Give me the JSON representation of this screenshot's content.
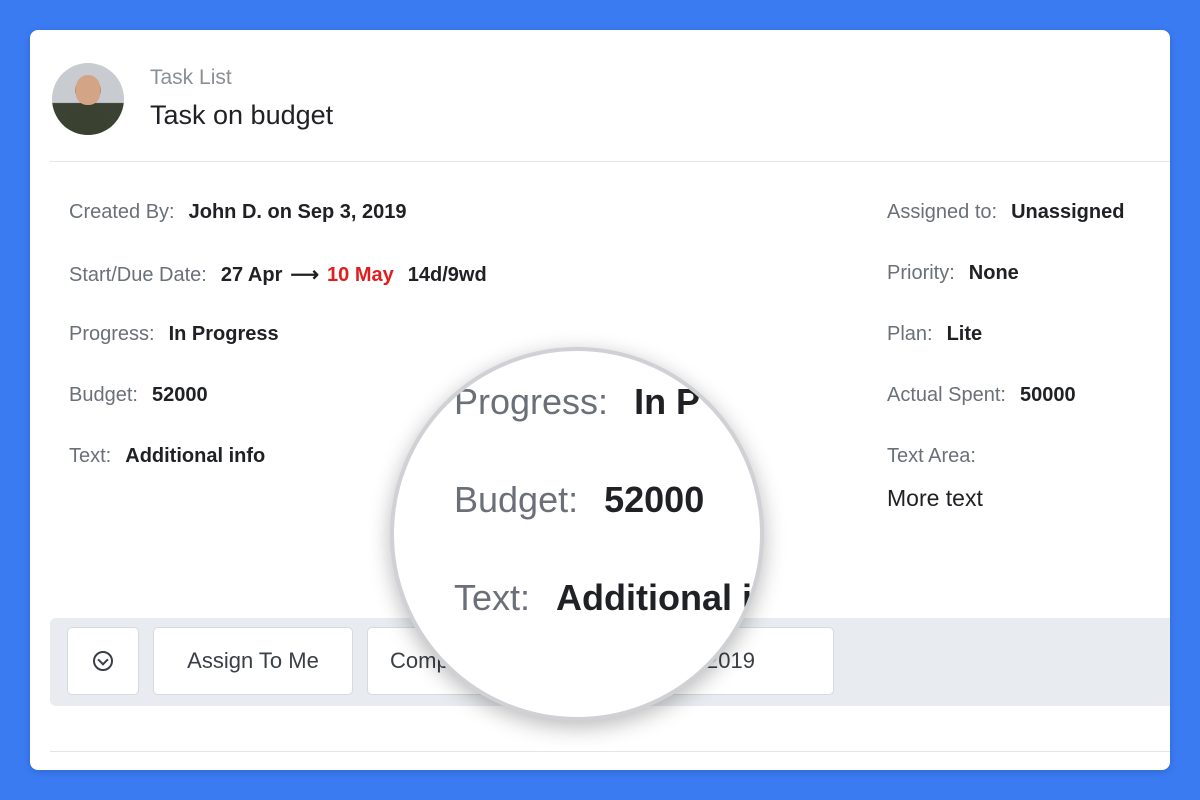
{
  "header": {
    "subtitle": "Task List",
    "title": "Task on budget"
  },
  "fields_left": {
    "created_by": {
      "label": "Created By:",
      "value": "John D. on Sep 3, 2019"
    },
    "dates": {
      "label": "Start/Due Date:",
      "start": "27 Apr",
      "arrow": "⟶",
      "due": "10 May",
      "duration": "14d/9wd"
    },
    "progress": {
      "label": "Progress:",
      "value": "In Progress"
    },
    "budget": {
      "label": "Budget:",
      "value": "52000"
    },
    "text": {
      "label": "Text:",
      "value": "Additional info"
    }
  },
  "fields_right": {
    "assigned": {
      "label": "Assigned to:",
      "value": "Unassigned"
    },
    "priority": {
      "label": "Priority:",
      "value": "None"
    },
    "plan": {
      "label": "Plan:",
      "value": "Lite"
    },
    "actual_spent": {
      "label": "Actual Spent:",
      "value": "50000"
    },
    "text_area": {
      "label": "Text Area:",
      "value": "More text"
    }
  },
  "toolbar": {
    "menu_icon": "chevron-down-circle-icon",
    "assign_label": "Assign To Me",
    "complete_label_partial": "Comp",
    "date_partial": "2019"
  },
  "magnifier": {
    "progress": {
      "label": "Progress:",
      "value": "In P"
    },
    "budget": {
      "label": "Budget:",
      "value": "52000"
    },
    "text": {
      "label": "Text:",
      "value": "Additional i"
    }
  },
  "colors": {
    "background": "#3B7BF2",
    "due_date": "#E01E1E"
  }
}
